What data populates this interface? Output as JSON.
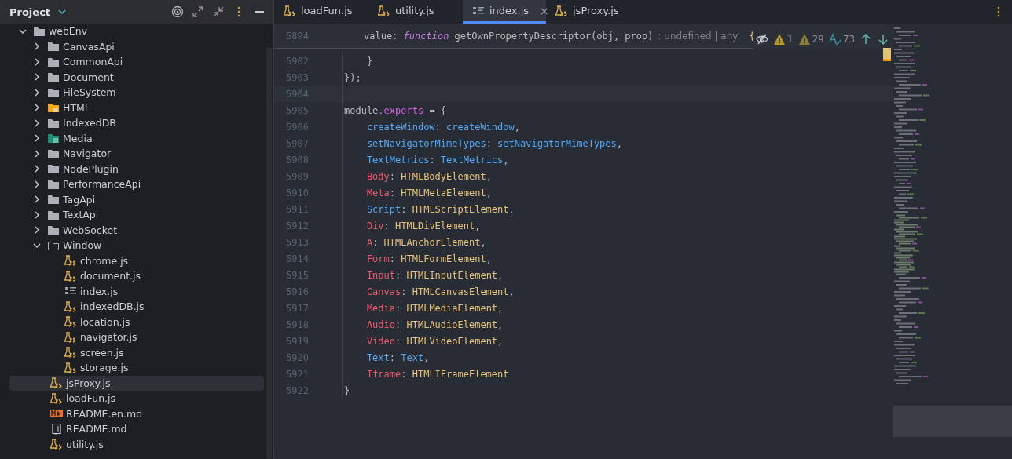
{
  "project_panel": {
    "title": "Project",
    "tree": [
      {
        "label": "webEnv",
        "kind": "folder",
        "expanded": true,
        "selected": false,
        "children": [
          {
            "label": "CanvasApi",
            "kind": "folder",
            "expanded": false,
            "selected": false
          },
          {
            "label": "CommonApi",
            "kind": "folder",
            "expanded": false,
            "selected": false
          },
          {
            "label": "Document",
            "kind": "folder",
            "expanded": false,
            "selected": false
          },
          {
            "label": "FileSystem",
            "kind": "folder",
            "expanded": false,
            "selected": false
          },
          {
            "label": "HTML",
            "kind": "htmlfolder",
            "expanded": false,
            "selected": false
          },
          {
            "label": "IndexedDB",
            "kind": "folder",
            "expanded": false,
            "selected": false
          },
          {
            "label": "Media",
            "kind": "mediafolder",
            "expanded": false,
            "selected": false
          },
          {
            "label": "Navigator",
            "kind": "folder",
            "expanded": false,
            "selected": false
          },
          {
            "label": "NodePlugin",
            "kind": "folder",
            "expanded": false,
            "selected": false
          },
          {
            "label": "PerformanceApi",
            "kind": "folder",
            "expanded": false,
            "selected": false
          },
          {
            "label": "TagApi",
            "kind": "folder",
            "expanded": false,
            "selected": false
          },
          {
            "label": "TextApi",
            "kind": "folder",
            "expanded": false,
            "selected": false
          },
          {
            "label": "WebSocket",
            "kind": "folder",
            "expanded": false,
            "selected": false
          },
          {
            "label": "Window",
            "kind": "openfolder",
            "expanded": true,
            "selected": false,
            "children": [
              {
                "label": "chrome.js",
                "kind": "js",
                "selected": false
              },
              {
                "label": "document.js",
                "kind": "js",
                "selected": false
              },
              {
                "label": "index.js",
                "kind": "list",
                "selected": false
              },
              {
                "label": "indexedDB.js",
                "kind": "js",
                "selected": false
              },
              {
                "label": "location.js",
                "kind": "js",
                "selected": false
              },
              {
                "label": "navigator.js",
                "kind": "js",
                "selected": false
              },
              {
                "label": "screen.js",
                "kind": "js",
                "selected": false
              },
              {
                "label": "storage.js",
                "kind": "js",
                "selected": false
              }
            ]
          },
          {
            "label": "jsProxy.js",
            "kind": "js",
            "selected": true
          },
          {
            "label": "loadFun.js",
            "kind": "js",
            "selected": false
          },
          {
            "label": "README.en.md",
            "kind": "md",
            "selected": false
          },
          {
            "label": "README.md",
            "kind": "book",
            "selected": false
          },
          {
            "label": "utility.js",
            "kind": "js",
            "selected": false
          }
        ]
      }
    ]
  },
  "tabs": [
    {
      "label": "loadFun.js",
      "kind": "js",
      "selected": false
    },
    {
      "label": "utility.js",
      "kind": "js",
      "selected": false
    },
    {
      "label": "index.js",
      "kind": "list",
      "selected": true,
      "close": "×"
    },
    {
      "label": "jsProxy.js",
      "kind": "js",
      "selected": false
    }
  ],
  "sticky_line": {
    "number": "5894",
    "tokens": [
      {
        "text": "value: ",
        "kind": "plain"
      },
      {
        "text": "function",
        "kind": "keyword"
      },
      {
        "text": " getOwnPropertyDescriptor(obj, prop)",
        "kind": "plain"
      }
    ],
    "hint": ": undefined | any",
    "brace": "{"
  },
  "inspections": [
    {
      "kind": "warning",
      "count": "1"
    },
    {
      "kind": "weak",
      "count": "29"
    },
    {
      "kind": "typo",
      "count": "73"
    }
  ],
  "code_lines": [
    {
      "number": "5902",
      "current": false,
      "tokens": [
        {
          "text": "    }",
          "kind": "plain"
        }
      ]
    },
    {
      "number": "5903",
      "current": false,
      "tokens": [
        {
          "text": "});",
          "kind": "plain"
        }
      ]
    },
    {
      "number": "5904",
      "current": true
    },
    {
      "number": "5905",
      "current": false,
      "tokens": [
        {
          "text": "module",
          "kind": "plain"
        },
        {
          "text": ".exports",
          "kind": "member"
        },
        {
          "text": " = {",
          "kind": "plain"
        }
      ]
    },
    {
      "number": "5906",
      "current": false,
      "tokens": [
        {
          "text": "    createWindow",
          "kind": "prop"
        },
        {
          "text": ": ",
          "kind": "plain"
        },
        {
          "text": "createWindow",
          "kind": "prop"
        },
        {
          "text": ",",
          "kind": "plain"
        }
      ]
    },
    {
      "number": "5907",
      "current": false,
      "tokens": [
        {
          "text": "    setNavigatorMimeTypes",
          "kind": "prop"
        },
        {
          "text": ": ",
          "kind": "plain"
        },
        {
          "text": "setNavigatorMimeTypes",
          "kind": "prop"
        },
        {
          "text": ",",
          "kind": "plain"
        }
      ]
    },
    {
      "number": "5908",
      "current": false,
      "tokens": [
        {
          "text": "    TextMetrics",
          "kind": "prop"
        },
        {
          "text": ": ",
          "kind": "plain"
        },
        {
          "text": "TextMetrics",
          "kind": "prop"
        },
        {
          "text": ",",
          "kind": "plain"
        }
      ]
    },
    {
      "number": "5909",
      "current": false,
      "tokens": [
        {
          "text": "    Body",
          "kind": "key"
        },
        {
          "text": ": ",
          "kind": "plain"
        },
        {
          "text": "HTMLBodyElement",
          "kind": "class"
        },
        {
          "text": ",",
          "kind": "plain"
        }
      ]
    },
    {
      "number": "5910",
      "current": false,
      "tokens": [
        {
          "text": "    Meta",
          "kind": "key"
        },
        {
          "text": ": ",
          "kind": "plain"
        },
        {
          "text": "HTMLMetaElement",
          "kind": "class"
        },
        {
          "text": ",",
          "kind": "plain"
        }
      ]
    },
    {
      "number": "5911",
      "current": false,
      "tokens": [
        {
          "text": "    Script",
          "kind": "prop"
        },
        {
          "text": ": ",
          "kind": "plain"
        },
        {
          "text": "HTMLScriptElement",
          "kind": "class"
        },
        {
          "text": ",",
          "kind": "plain"
        }
      ]
    },
    {
      "number": "5912",
      "current": false,
      "tokens": [
        {
          "text": "    Div",
          "kind": "key"
        },
        {
          "text": ": ",
          "kind": "plain"
        },
        {
          "text": "HTMLDivElement",
          "kind": "class"
        },
        {
          "text": ",",
          "kind": "plain"
        }
      ]
    },
    {
      "number": "5913",
      "current": false,
      "tokens": [
        {
          "text": "    A",
          "kind": "key"
        },
        {
          "text": ": ",
          "kind": "plain"
        },
        {
          "text": "HTMLAnchorElement",
          "kind": "class"
        },
        {
          "text": ",",
          "kind": "plain"
        }
      ]
    },
    {
      "number": "5914",
      "current": false,
      "tokens": [
        {
          "text": "    Form",
          "kind": "key"
        },
        {
          "text": ": ",
          "kind": "plain"
        },
        {
          "text": "HTMLFormElement",
          "kind": "class"
        },
        {
          "text": ",",
          "kind": "plain"
        }
      ]
    },
    {
      "number": "5915",
      "current": false,
      "tokens": [
        {
          "text": "    Input",
          "kind": "key"
        },
        {
          "text": ": ",
          "kind": "plain"
        },
        {
          "text": "HTMLInputElement",
          "kind": "class"
        },
        {
          "text": ",",
          "kind": "plain"
        }
      ]
    },
    {
      "number": "5916",
      "current": false,
      "tokens": [
        {
          "text": "    Canvas",
          "kind": "key"
        },
        {
          "text": ": ",
          "kind": "plain"
        },
        {
          "text": "HTMLCanvasElement",
          "kind": "class"
        },
        {
          "text": ",",
          "kind": "plain"
        }
      ]
    },
    {
      "number": "5917",
      "current": false,
      "tokens": [
        {
          "text": "    Media",
          "kind": "key"
        },
        {
          "text": ": ",
          "kind": "plain"
        },
        {
          "text": "HTMLMediaElement",
          "kind": "class"
        },
        {
          "text": ",",
          "kind": "plain"
        }
      ]
    },
    {
      "number": "5918",
      "current": false,
      "tokens": [
        {
          "text": "    Audio",
          "kind": "key"
        },
        {
          "text": ": ",
          "kind": "plain"
        },
        {
          "text": "HTMLAudioElement",
          "kind": "class"
        },
        {
          "text": ",",
          "kind": "plain"
        }
      ]
    },
    {
      "number": "5919",
      "current": false,
      "tokens": [
        {
          "text": "    Video",
          "kind": "key"
        },
        {
          "text": ": ",
          "kind": "plain"
        },
        {
          "text": "HTMLVideoElement",
          "kind": "class"
        },
        {
          "text": ",",
          "kind": "plain"
        }
      ]
    },
    {
      "number": "5920",
      "current": false,
      "tokens": [
        {
          "text": "    Text",
          "kind": "prop"
        },
        {
          "text": ": ",
          "kind": "plain"
        },
        {
          "text": "Text",
          "kind": "prop"
        },
        {
          "text": ",",
          "kind": "plain"
        }
      ]
    },
    {
      "number": "5921",
      "current": false,
      "tokens": [
        {
          "text": "    Iframe",
          "kind": "key"
        },
        {
          "text": ": ",
          "kind": "plain"
        },
        {
          "text": "HTMLIFrameElement",
          "kind": "class"
        }
      ]
    },
    {
      "number": "5922",
      "current": false,
      "tokens": [
        {
          "text": "}",
          "kind": "plain"
        }
      ]
    }
  ]
}
